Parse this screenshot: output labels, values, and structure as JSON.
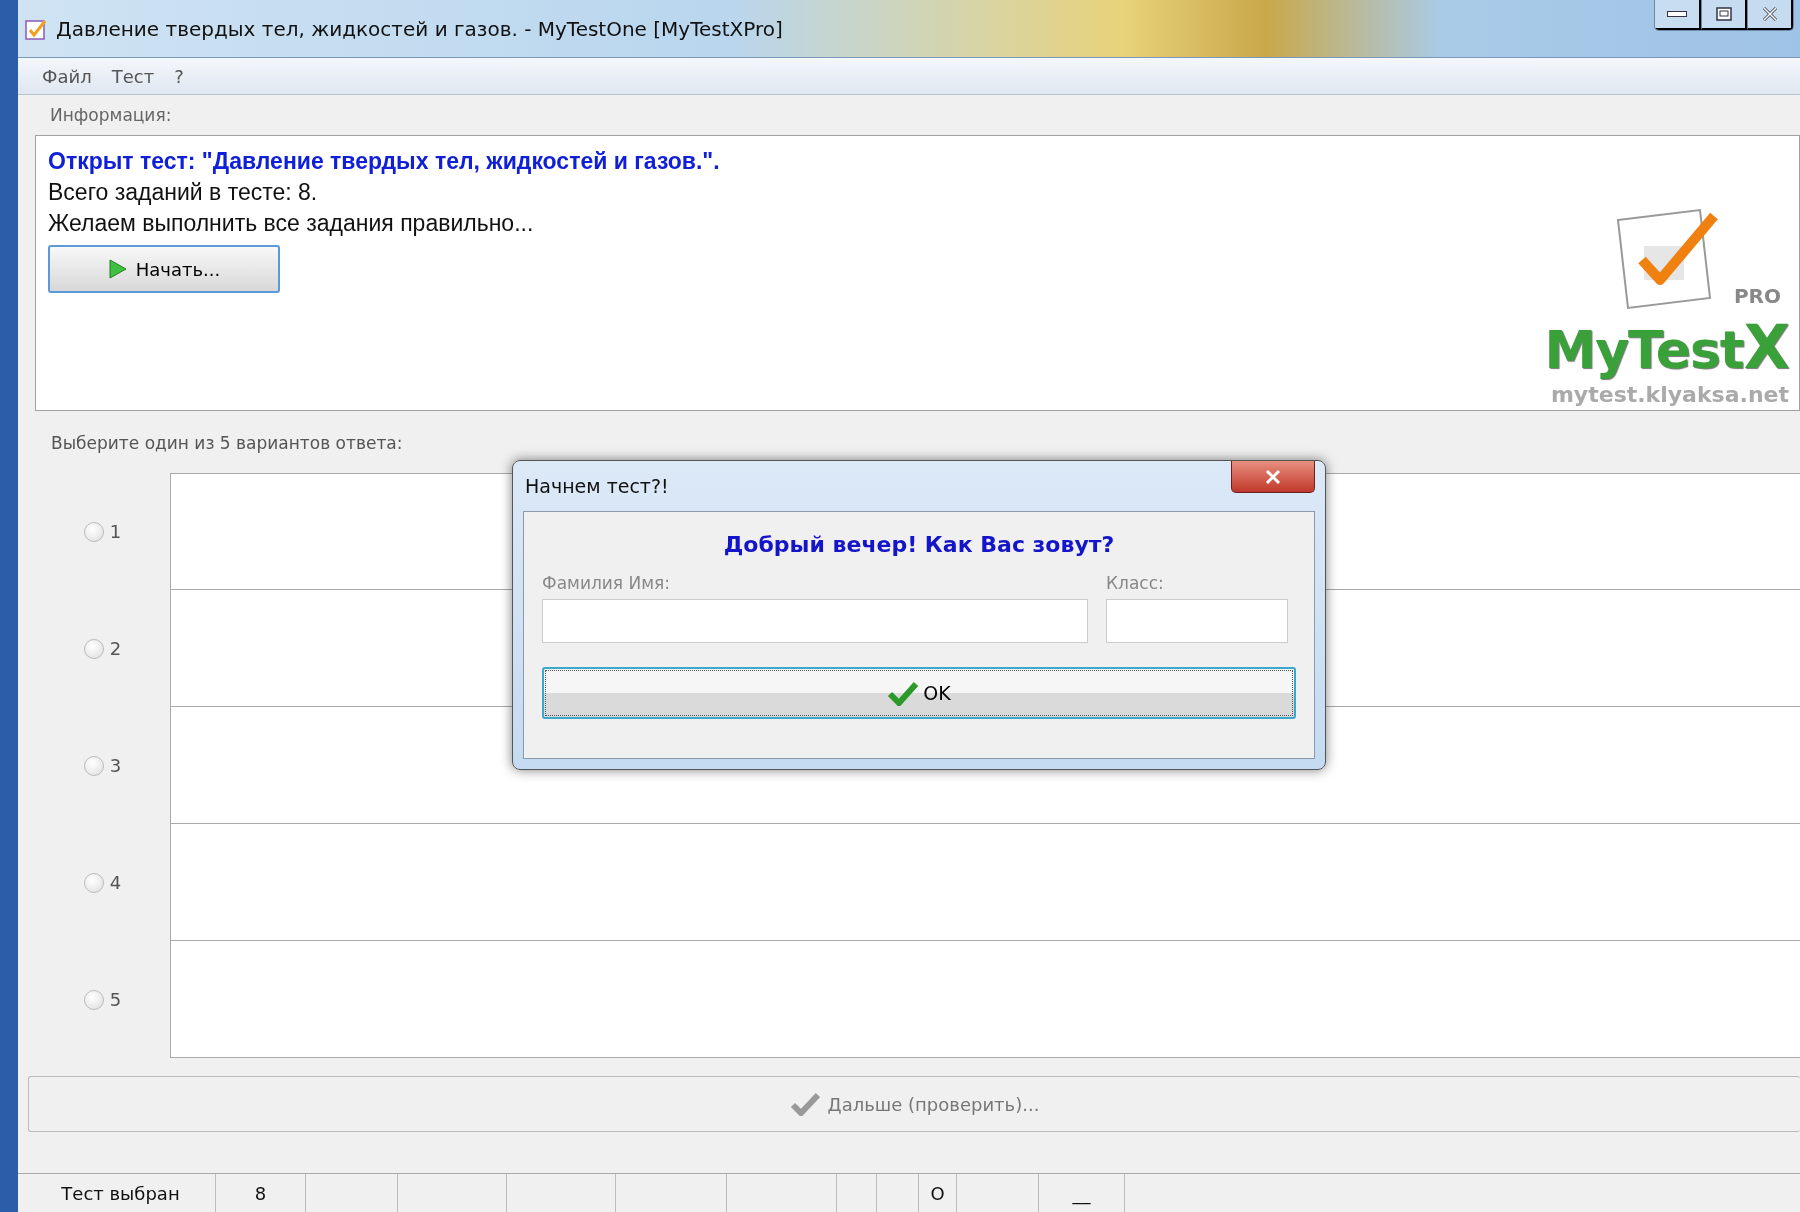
{
  "window": {
    "title": "Давление твердых тел, жидкостей и газов. - MyTestOne [MyTestXPro]"
  },
  "menu": [
    {
      "label": "Файл"
    },
    {
      "label": "Тест"
    },
    {
      "label": "?"
    }
  ],
  "info": {
    "label": "Информация:",
    "heading": "Открыт тест: \"Давление твердых тел, жидкостей и газов.\".",
    "lines": [
      "Всего заданий в тесте: 8.",
      "Желаем выполнить все задания правильно..."
    ],
    "start_button": "Начать...",
    "logo": {
      "badge": "PRO",
      "name": "MyTest",
      "name_x": "X",
      "url": "mytest.klyaksa.net"
    }
  },
  "answers": {
    "prompt": "Выберите один из 5 вариантов ответа:",
    "options": [
      {
        "label": "1",
        "selected": false
      },
      {
        "label": "2",
        "selected": false
      },
      {
        "label": "3",
        "selected": false
      },
      {
        "label": "4",
        "selected": false
      },
      {
        "label": "5",
        "selected": false
      }
    ]
  },
  "next_button": {
    "label": "Дальше (проверить)...",
    "disabled": true
  },
  "status_bar": [
    {
      "text": "Тест выбран"
    },
    {
      "text": "8"
    },
    {
      "text": "O"
    },
    {
      "text": "__"
    }
  ],
  "dialog": {
    "title": "Начнем тест?!",
    "heading": "Добрый вечер! Как Вас зовут?",
    "name_label": "Фамилия Имя:",
    "class_label": "Класс:",
    "ok_button": "OK"
  }
}
